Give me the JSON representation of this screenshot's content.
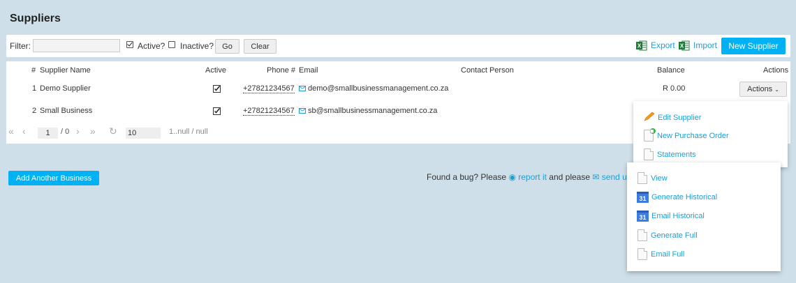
{
  "page": {
    "title": "Suppliers"
  },
  "filter": {
    "label": "Filter:",
    "value": "",
    "active_label": "Active?",
    "active_checked": true,
    "inactive_label": "Inactive?",
    "inactive_checked": false,
    "go_label": "Go",
    "clear_label": "Clear",
    "export_label": "Export",
    "import_label": "Import",
    "new_supplier_label": "New Supplier"
  },
  "table": {
    "headers": {
      "num": "#",
      "name": "Supplier Name",
      "active": "Active",
      "phone": "Phone #",
      "email": "Email",
      "contact": "Contact Person",
      "balance": "Balance",
      "actions": "Actions"
    },
    "rows": [
      {
        "num": "1",
        "name": "Demo Supplier",
        "active": true,
        "phone": "+27821234567",
        "email": "demo@smallbusinessmanagement.co.za",
        "contact": "",
        "balance": "R 0.00",
        "actions_label": "Actions"
      },
      {
        "num": "2",
        "name": "Small Business",
        "active": true,
        "phone": "+27821234567",
        "email": "sb@smallbusinessmanagement.co.za",
        "contact": "",
        "balance": ""
      }
    ]
  },
  "pager": {
    "page": "1",
    "of": "/ 0",
    "page_size": "10",
    "range": "1..null / null"
  },
  "add_business_label": "Add Another Business",
  "footer": {
    "prefix": "Found a bug? Please",
    "report_link": "report it",
    "middle": "and please",
    "send_link": "send us"
  },
  "actions_menu": {
    "items": [
      {
        "label": "Edit Supplier",
        "icon": "pencil-icon"
      },
      {
        "label": "New Purchase Order",
        "icon": "new-document-icon"
      },
      {
        "label": "Statements",
        "icon": "document-icon"
      }
    ]
  },
  "statements_menu": {
    "items": [
      {
        "label": "View",
        "icon": "document-icon"
      },
      {
        "label": "Generate Historical",
        "icon": "calendar-icon",
        "calendar_text": "31"
      },
      {
        "label": "Email Historical",
        "icon": "calendar-icon",
        "calendar_text": "31"
      },
      {
        "label": "Generate Full",
        "icon": "document-icon"
      },
      {
        "label": "Email Full",
        "icon": "document-icon"
      }
    ]
  },
  "colors": {
    "background": "#cfdfe9",
    "primary": "#00b1f3",
    "link": "#1a9fd4",
    "excel_green": "#1f7a3a",
    "calendar_blue": "#3e7be0",
    "pencil_orange": "#f29b1d"
  }
}
